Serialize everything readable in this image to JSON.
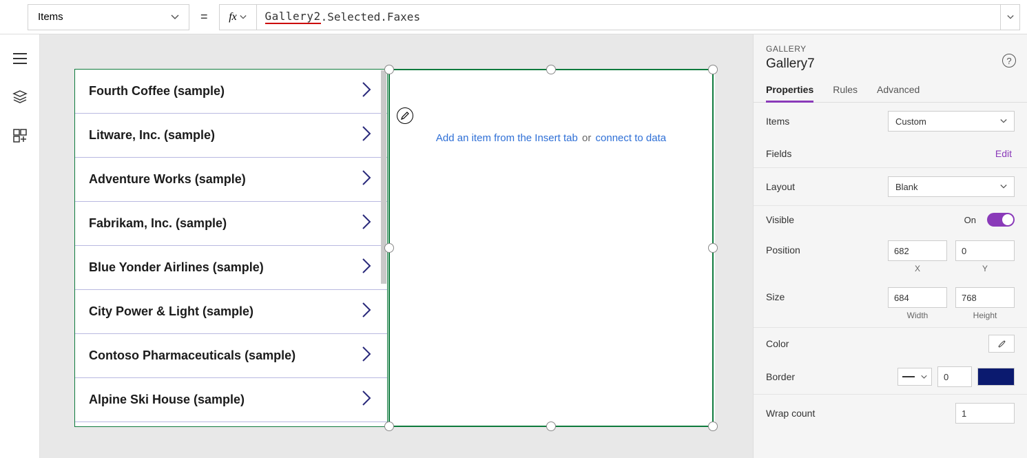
{
  "formula_bar": {
    "property": "Items",
    "equals": "=",
    "fx_label": "fx",
    "expression_part1": "Gallery2",
    "expression_part2": ".Selected.Faxes"
  },
  "gallery1_items": [
    "Fourth Coffee (sample)",
    "Litware, Inc. (sample)",
    "Adventure Works (sample)",
    "Fabrikam, Inc. (sample)",
    "Blue Yonder Airlines (sample)",
    "City Power & Light (sample)",
    "Contoso Pharmaceuticals (sample)",
    "Alpine Ski House (sample)"
  ],
  "gallery2_placeholder": {
    "insert_text": "Add an item from the Insert tab",
    "or": " or ",
    "connect_text": "connect to data"
  },
  "props": {
    "type_label": "GALLERY",
    "name": "Gallery7",
    "tabs": {
      "properties": "Properties",
      "rules": "Rules",
      "advanced": "Advanced"
    },
    "items_label": "Items",
    "items_value": "Custom",
    "fields_label": "Fields",
    "fields_action": "Edit",
    "layout_label": "Layout",
    "layout_value": "Blank",
    "visible_label": "Visible",
    "visible_state": "On",
    "position_label": "Position",
    "position_x": "682",
    "position_y": "0",
    "x_label": "X",
    "y_label": "Y",
    "size_label": "Size",
    "size_w": "684",
    "size_h": "768",
    "w_label": "Width",
    "h_label": "Height",
    "color_label": "Color",
    "border_label": "Border",
    "border_width": "0",
    "wrap_label": "Wrap count",
    "wrap_value": "1"
  }
}
